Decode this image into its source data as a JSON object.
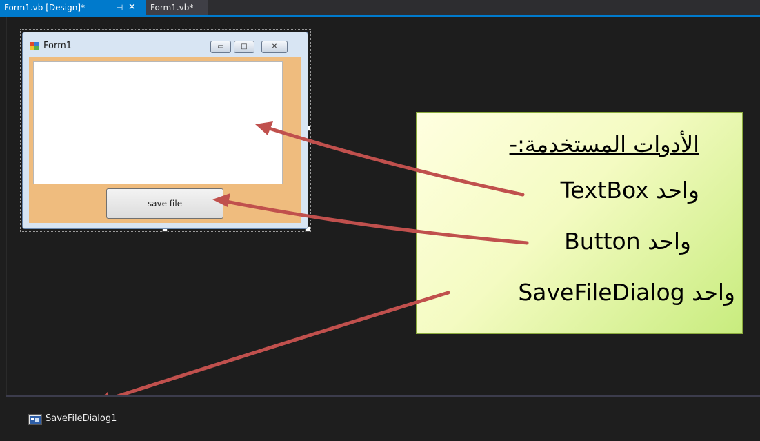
{
  "tabs": {
    "active_label": "Form1.vb [Design]*",
    "second_label": "Form1.vb*",
    "pin_glyph": "⊣",
    "close_glyph": "✕"
  },
  "form": {
    "title": "Form1",
    "minimize_glyph": "▭",
    "maximize_glyph": "□",
    "close_glyph": "✕",
    "button_label": "save file",
    "client_color": "#efbc7e"
  },
  "callout": {
    "heading": "الأدوات المستخدمة:-",
    "line1": "واحد TextBox",
    "line2": "واحد Button",
    "line3": "واحد SaveFileDialog"
  },
  "tray": {
    "component_label": "SaveFileDialog1"
  },
  "colors": {
    "accent": "#007acc",
    "arrow": "#c0504d",
    "callout_border": "#8bab3d"
  }
}
